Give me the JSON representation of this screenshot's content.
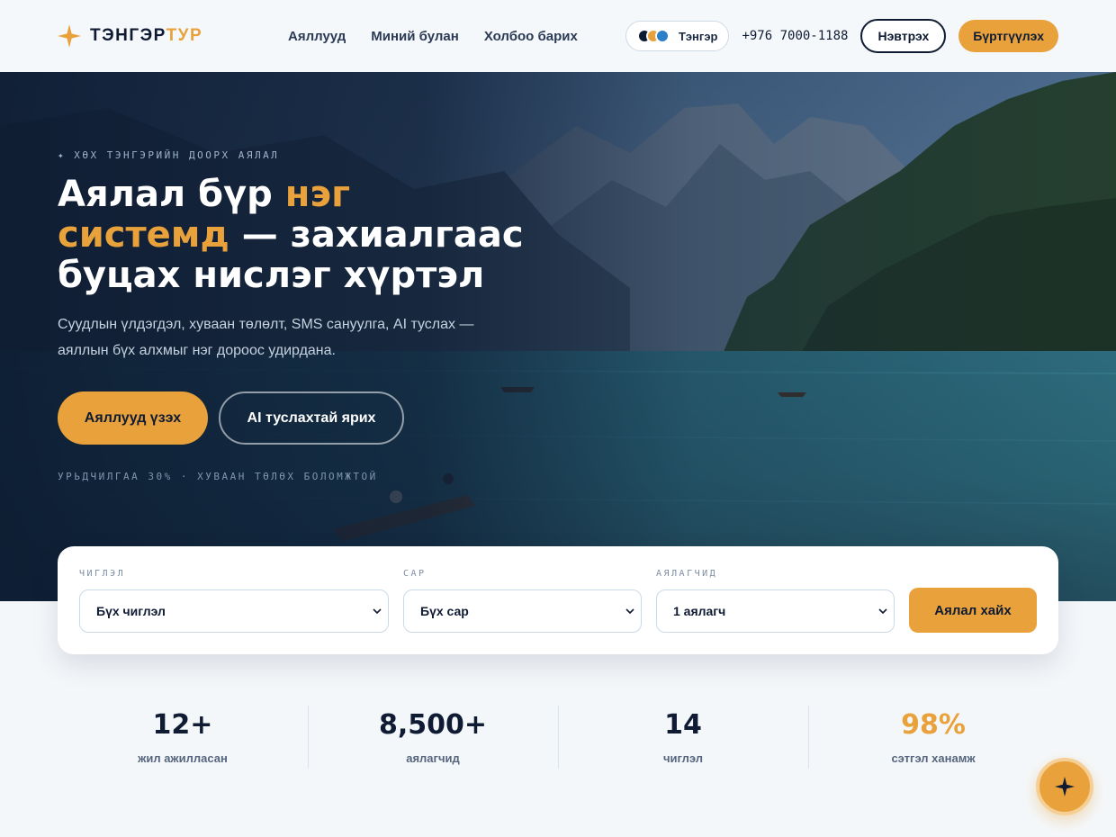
{
  "brand": {
    "logo_primary": "ТЭНГЭР",
    "logo_accent": "ТУР",
    "icon": "four-point-star-icon"
  },
  "nav": {
    "items": [
      {
        "label": "Аяллууд"
      },
      {
        "label": "Миний булан"
      },
      {
        "label": "Холбоо барих"
      }
    ]
  },
  "header": {
    "brand_pill_label": "Тэнгэр",
    "phone": "+976 7000-1188",
    "login_label": "Нэвтрэх",
    "register_label": "Бүртгүүлэх"
  },
  "hero": {
    "eyebrow": "✦ ХӨХ ТЭНГЭРИЙН ДООРХ АЯЛАЛ",
    "title_part1": "Аялал бүр ",
    "title_highlight": "нэг системд",
    "title_part2": " — захиалгаас буцах нислэг хүртэл",
    "subtitle": "Суудлын үлдэгдэл, хуваан төлөлт, SMS сануулга, AI туслах — аяллын бүх алхмыг нэг дороос удирдана.",
    "primary_cta": "Аяллууд үзэх",
    "secondary_cta": "AI туслахтай ярих",
    "note": "УРЬДЧИЛГАА 30% · ХУВААН ТӨЛӨХ БОЛОМЖТОЙ"
  },
  "search": {
    "destination": {
      "label": "ЧИГЛЭЛ",
      "value": "Бүх чиглэл"
    },
    "month": {
      "label": "САР",
      "value": "Бүх сар"
    },
    "travelers": {
      "label": "АЯЛАГЧИД",
      "value": "1 аялагч"
    },
    "submit_label": "Аялал хайх"
  },
  "stats": [
    {
      "value": "12+",
      "label": "жил ажилласан"
    },
    {
      "value": "8,500+",
      "label": "аялагчид"
    },
    {
      "value": "14",
      "label": "чиглэл"
    },
    {
      "value": "98%",
      "label": "сэтгэл ханамж"
    }
  ],
  "colors": {
    "accent": "#e9a23b",
    "navy": "#0f1b33",
    "page_bg": "#f4f7fa"
  }
}
